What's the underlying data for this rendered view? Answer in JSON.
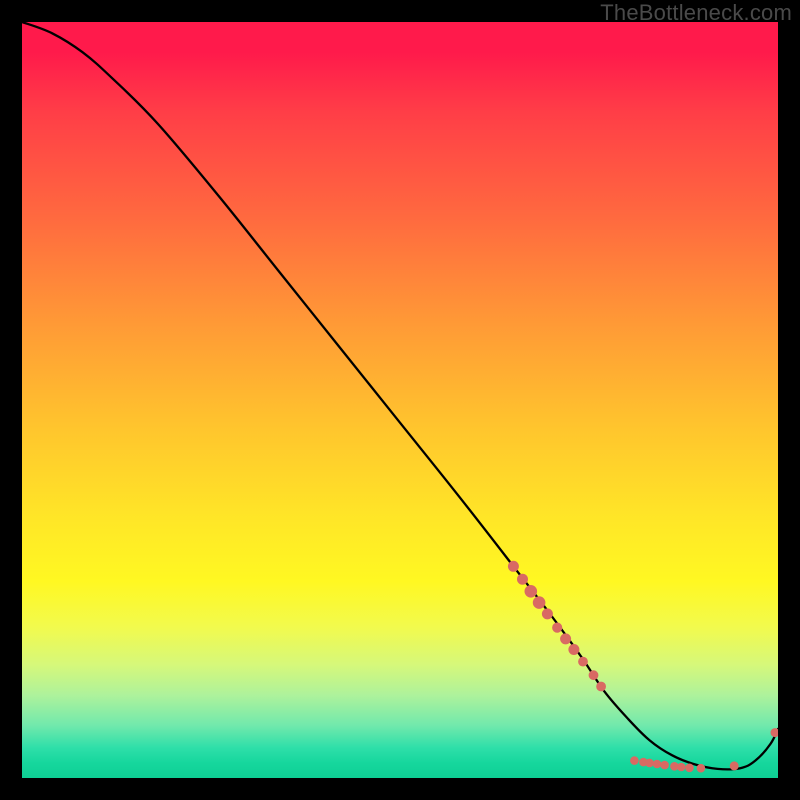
{
  "watermark": "TheBottleneck.com",
  "colors": {
    "dot": "#d96a63",
    "curve": "#000000"
  },
  "chart_data": {
    "type": "line",
    "title": "",
    "xlabel": "",
    "ylabel": "",
    "xlim": [
      0,
      100
    ],
    "ylim": [
      0,
      100
    ],
    "grid": false,
    "legend": false,
    "series": [
      {
        "name": "bottleneck-curve",
        "x": [
          0,
          4,
          8,
          12,
          18,
          26,
          34,
          42,
          50,
          58,
          65,
          70,
          74,
          77,
          80,
          83,
          86,
          89,
          92,
          95,
          97,
          99,
          100
        ],
        "y": [
          100,
          98.5,
          96,
          92.5,
          86.5,
          77,
          67,
          57,
          47,
          37,
          28,
          21.5,
          16,
          11.5,
          8,
          5,
          3,
          1.8,
          1.2,
          1.3,
          2.3,
          4.5,
          6.5
        ]
      }
    ],
    "markers": [
      {
        "x": 65.0,
        "y": 28.0,
        "r": 5.0
      },
      {
        "x": 66.2,
        "y": 26.3,
        "r": 5.0
      },
      {
        "x": 67.3,
        "y": 24.7,
        "r": 5.8
      },
      {
        "x": 68.4,
        "y": 23.2,
        "r": 5.8
      },
      {
        "x": 69.5,
        "y": 21.7,
        "r": 5.0
      },
      {
        "x": 70.8,
        "y": 19.9,
        "r": 4.6
      },
      {
        "x": 71.9,
        "y": 18.4,
        "r": 5.0
      },
      {
        "x": 73.0,
        "y": 17.0,
        "r": 5.0
      },
      {
        "x": 74.2,
        "y": 15.4,
        "r": 4.4
      },
      {
        "x": 75.6,
        "y": 13.6,
        "r": 4.4
      },
      {
        "x": 76.6,
        "y": 12.1,
        "r": 4.4
      },
      {
        "x": 81.0,
        "y": 2.3,
        "r": 3.8
      },
      {
        "x": 82.2,
        "y": 2.1,
        "r": 3.8
      },
      {
        "x": 83.0,
        "y": 2.0,
        "r": 3.8
      },
      {
        "x": 84.0,
        "y": 1.85,
        "r": 3.8
      },
      {
        "x": 85.0,
        "y": 1.7,
        "r": 3.8
      },
      {
        "x": 86.3,
        "y": 1.55,
        "r": 3.8
      },
      {
        "x": 87.2,
        "y": 1.45,
        "r": 3.8
      },
      {
        "x": 88.3,
        "y": 1.35,
        "r": 3.8
      },
      {
        "x": 89.8,
        "y": 1.3,
        "r": 3.8
      },
      {
        "x": 94.2,
        "y": 1.6,
        "r": 4.0
      },
      {
        "x": 99.6,
        "y": 6.0,
        "r": 4.0
      }
    ]
  }
}
